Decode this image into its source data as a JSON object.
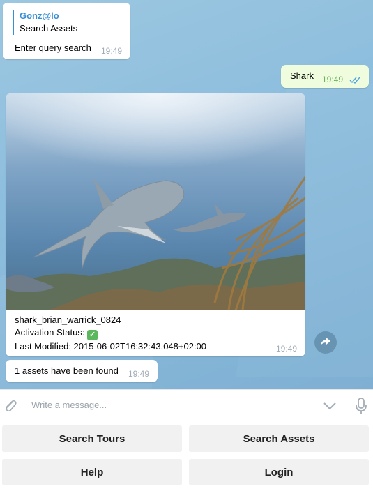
{
  "messages": {
    "bot_prompt": {
      "reply_name": "Gonz@lo",
      "reply_text": "Search Assets",
      "text": "Enter query search",
      "time": "19:49"
    },
    "user_query": {
      "text": "Shark",
      "time": "19:49",
      "status_icon": "double-check-icon"
    },
    "asset_result": {
      "name": "shark_brian_warrick_0824",
      "status_label": "Activation Status:",
      "status_icon": "white-check-mark-emoji",
      "modified": "Last Modified: 2015-06-02T16:32:43.048+02:00",
      "time": "19:49",
      "share_icon": "share-arrow-icon"
    },
    "count": {
      "text": "1 assets have been found",
      "time": "19:49"
    }
  },
  "composer": {
    "placeholder": "Write a message...",
    "attach_icon": "paperclip-icon",
    "keyboard_toggle_icon": "chevron-down-icon",
    "voice_icon": "microphone-icon"
  },
  "keyboard": {
    "buttons": [
      "Search Tours",
      "Search Assets",
      "Help",
      "Login"
    ]
  },
  "colors": {
    "accent": "#3a8fd2",
    "outgoing_bubble": "#effdde",
    "chat_background": "#8fbfde"
  }
}
